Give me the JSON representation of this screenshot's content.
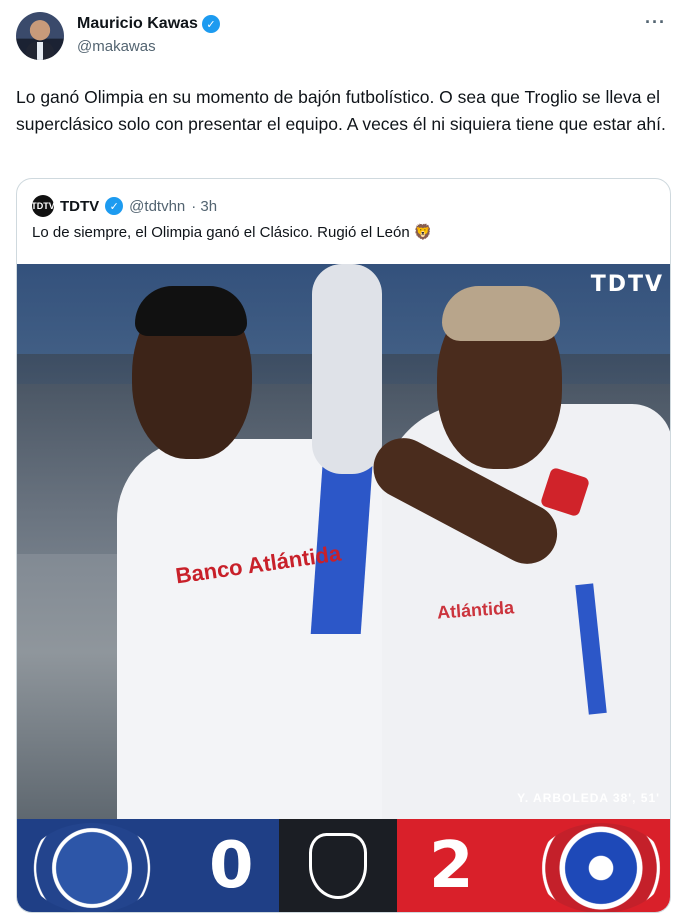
{
  "author": {
    "name": "Mauricio Kawas",
    "handle": "@makawas",
    "verified_icon": "verified-badge-icon",
    "more_label": "···"
  },
  "tweet": {
    "text": "Lo ganó Olimpia en su momento de bajón futbolístico. O sea que Troglio se lleva el superclásico solo con presentar el equipo. A veces él ni siquiera tiene que estar ahí."
  },
  "quoted": {
    "logo_text": "TDTV",
    "name": "TDTV",
    "handle": "@tdtvhn",
    "time": "· 3h",
    "text": "Lo de siempre, el Olimpia ganó el Clásico. Rugió el León 🦁",
    "image": {
      "watermark": "TDTV",
      "caption": "Y. ARBOLEDA 38', 51'",
      "sponsor_1": "Banco Atlántida",
      "sponsor_2": "Atlántida"
    },
    "scoreboard": {
      "home_score": "0",
      "away_score": "2",
      "home_color": "#1f3f86",
      "away_color": "#d9202a",
      "center_color": "#1b1e24"
    }
  },
  "colors": {
    "verified": "#1d9bf0",
    "text_primary": "#0f1419",
    "text_secondary": "#536471",
    "border": "#cfd9de"
  }
}
